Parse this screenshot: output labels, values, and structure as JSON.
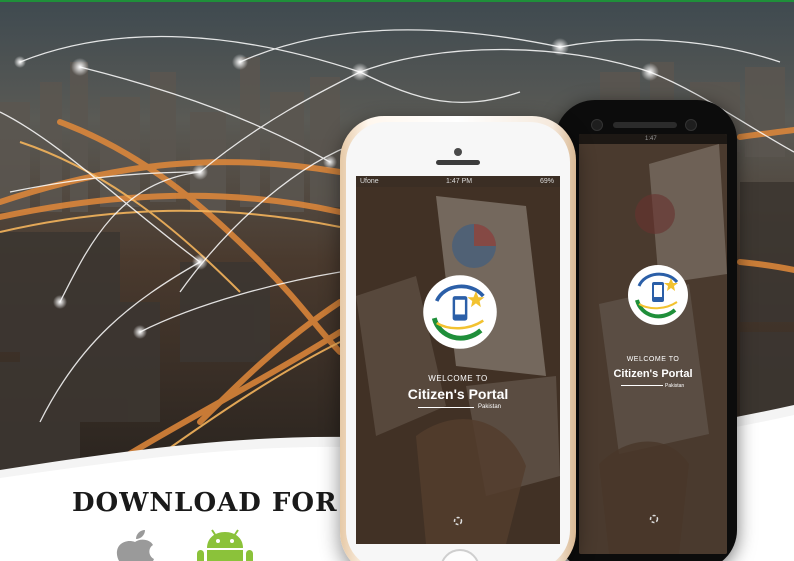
{
  "banner": {
    "download_title": "DOWNLOAD FOR",
    "platform_icons": [
      "apple-icon",
      "android-icon"
    ]
  },
  "phone_front": {
    "status": {
      "carrier": "Ufone",
      "time": "1:47 PM",
      "battery": "69%"
    },
    "welcome_text": "WELCOME TO",
    "app_name": "Citizen's Portal",
    "app_country": "Pakistan"
  },
  "phone_back": {
    "status": {
      "time": "1:47"
    },
    "welcome_text": "WELCOME TO",
    "app_name": "Citizen's Portal",
    "app_country": "Pakistan"
  },
  "colors": {
    "brand_green": "#1f8f3a",
    "logo_blue": "#2b5fa8",
    "logo_yellow": "#f2c230",
    "android_green": "#8bc23a",
    "apple_grey": "#9a9a9a"
  }
}
